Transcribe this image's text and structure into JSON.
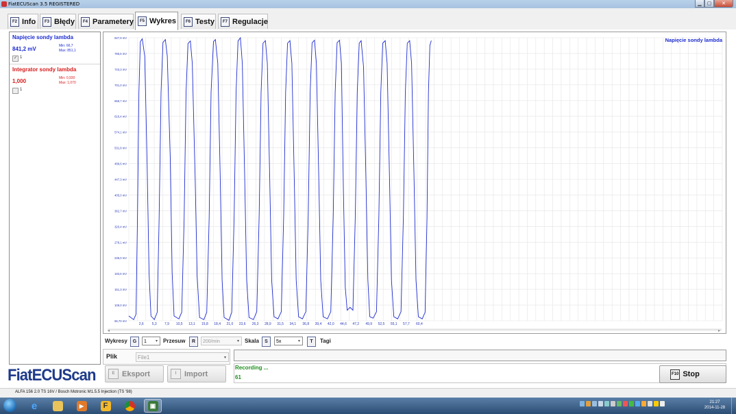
{
  "window": {
    "title": "FiatECUScan 3.5 REGISTERED"
  },
  "tabs": [
    {
      "key": "F2",
      "label": "Info"
    },
    {
      "key": "F3",
      "label": "Błędy"
    },
    {
      "key": "F4",
      "label": "Parametery"
    },
    {
      "key": "F5",
      "label": "Wykres"
    },
    {
      "key": "F6",
      "label": "Testy"
    },
    {
      "key": "F7",
      "label": "Regulacje"
    }
  ],
  "active_tab": "Wykres",
  "signals": [
    {
      "name": "Napięcie sondy lambda",
      "value": "841,2 mV",
      "min": "Min: 66,7",
      "max": "Max: 851,1",
      "checked": true,
      "checkbox_label": "1",
      "color": "#1c2bd0"
    },
    {
      "name": "Integrator sondy lambda",
      "value": "1,000",
      "min": "Min: 0,930",
      "max": "Max: 1,070",
      "checked": false,
      "checkbox_label": "1",
      "color": "#d81c1c"
    }
  ],
  "logo": "FiatECUScan",
  "controls": {
    "wykresy_label": "Wykresy",
    "wykresy_key": "G",
    "wykresy_value": "1",
    "przesuw_label": "Przesuw",
    "przesuw_key": "R",
    "przesuw_value": "200/min",
    "skala_label": "Skala",
    "skala_key": "S",
    "skala_value": "5x",
    "tagi_key": "T",
    "tagi_label": "Tagi"
  },
  "file": {
    "label": "Plik",
    "value": "File1"
  },
  "buttons": {
    "export_key": "E",
    "export_label": "Eksport",
    "import_key": "I",
    "import_label": "Import",
    "stop_key": "F10",
    "stop_label": "Stop"
  },
  "recording": {
    "status": "Recording ...",
    "count": "61"
  },
  "statusbar": {
    "vehicle": "ALFA 156 2.0 TS 16V / Bosch Motronic M1.5.5 Injection (TS '98)"
  },
  "taskbar": {
    "time": "21:27",
    "date": "2014-11-28"
  },
  "chart_data": {
    "type": "line",
    "title": "Napięcie sondy lambda",
    "ylim": [
      66.7,
      851.1
    ],
    "y_ticks": [
      "66,70 mV",
      "109,0 mV",
      "151,3 mV",
      "193,6 mV",
      "236,0 mV",
      "278,1 mV",
      "320,4 mV",
      "362,7 mV",
      "405,0 mV",
      "447,3 mV",
      "489,6 mV",
      "531,8 mV",
      "574,1 mV",
      "616,4 mV",
      "658,7 mV",
      "701,0 mV",
      "743,3 mV",
      "785,6 mV",
      "827,9 mV"
    ],
    "x_ticks": [
      "2,6",
      "5,3",
      "7,9",
      "10,5",
      "13,1",
      "15,8",
      "18,4",
      "21,0",
      "23,6",
      "26,3",
      "28,9",
      "31,5",
      "34,1",
      "36,8",
      "39,4",
      "42,0",
      "44,6",
      "47,2",
      "49,9",
      "52,5",
      "55,1",
      "57,7",
      "60,4"
    ],
    "xlim": [
      0,
      123.4
    ],
    "grid": true,
    "legend": "top-right",
    "series": [
      {
        "name": "Napięcie sondy lambda",
        "color": "#1c2bd0",
        "points": [
          [
            0.0,
            80
          ],
          [
            1.0,
            70
          ],
          [
            1.5,
            85
          ],
          [
            1.8,
            350
          ],
          [
            2.1,
            700
          ],
          [
            2.4,
            840
          ],
          [
            2.8,
            848
          ],
          [
            3.3,
            800
          ],
          [
            3.8,
            500
          ],
          [
            4.2,
            200
          ],
          [
            4.6,
            80
          ],
          [
            5.3,
            70
          ],
          [
            5.9,
            90
          ],
          [
            6.3,
            350
          ],
          [
            6.7,
            700
          ],
          [
            7.1,
            838
          ],
          [
            7.6,
            846
          ],
          [
            8.0,
            800
          ],
          [
            8.6,
            520
          ],
          [
            9.0,
            200
          ],
          [
            9.4,
            80
          ],
          [
            10.4,
            72
          ],
          [
            11.0,
            90
          ],
          [
            11.5,
            350
          ],
          [
            11.9,
            700
          ],
          [
            12.3,
            835
          ],
          [
            12.8,
            842
          ],
          [
            13.2,
            780
          ],
          [
            13.8,
            460
          ],
          [
            14.2,
            190
          ],
          [
            14.7,
            76
          ],
          [
            15.6,
            70
          ],
          [
            16.2,
            90
          ],
          [
            16.7,
            350
          ],
          [
            17.1,
            700
          ],
          [
            17.6,
            840
          ],
          [
            18.0,
            846
          ],
          [
            18.5,
            780
          ],
          [
            19.0,
            470
          ],
          [
            19.4,
            180
          ],
          [
            19.8,
            76
          ],
          [
            20.8,
            68
          ],
          [
            21.4,
            90
          ],
          [
            21.9,
            360
          ],
          [
            22.3,
            700
          ],
          [
            22.7,
            842
          ],
          [
            23.2,
            851
          ],
          [
            23.6,
            780
          ],
          [
            24.1,
            460
          ],
          [
            24.5,
            180
          ],
          [
            25.0,
            76
          ],
          [
            25.9,
            70
          ],
          [
            26.6,
            92
          ],
          [
            27.1,
            360
          ],
          [
            27.5,
            700
          ],
          [
            27.9,
            836
          ],
          [
            28.4,
            843
          ],
          [
            28.8,
            780
          ],
          [
            29.3,
            460
          ],
          [
            29.7,
            180
          ],
          [
            30.2,
            78
          ],
          [
            31.0,
            72
          ],
          [
            31.7,
            92
          ],
          [
            32.2,
            360
          ],
          [
            32.6,
            700
          ],
          [
            33.0,
            836
          ],
          [
            33.5,
            843
          ],
          [
            33.9,
            780
          ],
          [
            34.4,
            460
          ],
          [
            34.8,
            180
          ],
          [
            35.3,
            78
          ],
          [
            36.1,
            72
          ],
          [
            36.8,
            92
          ],
          [
            37.3,
            360
          ],
          [
            37.7,
            700
          ],
          [
            38.1,
            837
          ],
          [
            38.6,
            844
          ],
          [
            39.0,
            780
          ],
          [
            39.5,
            460
          ],
          [
            39.9,
            180
          ],
          [
            40.4,
            78
          ],
          [
            41.3,
            72
          ],
          [
            42.0,
            92
          ],
          [
            42.5,
            360
          ],
          [
            42.9,
            700
          ],
          [
            43.3,
            837
          ],
          [
            43.8,
            844
          ],
          [
            44.2,
            780
          ],
          [
            44.6,
            440
          ],
          [
            45.0,
            160
          ],
          [
            45.4,
            96
          ],
          [
            46.0,
            104
          ],
          [
            46.6,
            96
          ],
          [
            47.1,
            360
          ],
          [
            47.5,
            700
          ],
          [
            47.9,
            836
          ],
          [
            48.3,
            843
          ],
          [
            48.8,
            770
          ],
          [
            49.3,
            460
          ],
          [
            49.7,
            180
          ],
          [
            50.1,
            78
          ],
          [
            50.8,
            74
          ],
          [
            51.5,
            92
          ],
          [
            52.0,
            360
          ],
          [
            52.4,
            700
          ],
          [
            52.8,
            836
          ],
          [
            53.3,
            843
          ],
          [
            53.7,
            780
          ],
          [
            54.2,
            460
          ],
          [
            54.6,
            180
          ],
          [
            55.1,
            78
          ],
          [
            55.9,
            72
          ],
          [
            56.6,
            92
          ],
          [
            57.1,
            360
          ],
          [
            57.5,
            700
          ],
          [
            57.9,
            836
          ],
          [
            58.4,
            843
          ],
          [
            58.8,
            780
          ],
          [
            59.3,
            460
          ],
          [
            59.7,
            180
          ],
          [
            60.2,
            78
          ],
          [
            61.0,
            72
          ],
          [
            61.6,
            90
          ],
          [
            62.0,
            350
          ],
          [
            62.3,
            700
          ],
          [
            62.6,
            830
          ],
          [
            62.9,
            843
          ]
        ]
      }
    ]
  }
}
